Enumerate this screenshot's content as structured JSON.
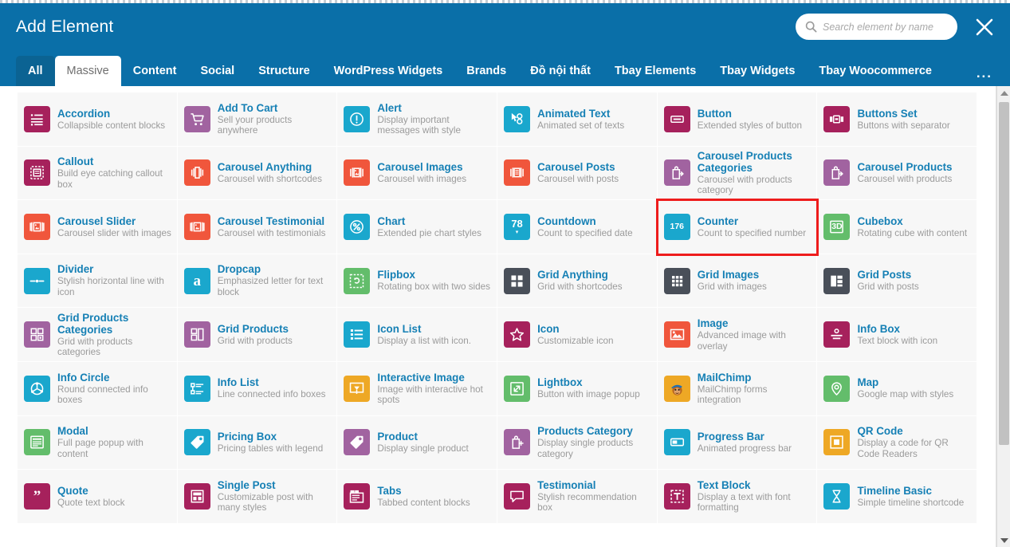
{
  "header": {
    "title": "Add Element",
    "search": {
      "placeholder": "Search element by name",
      "value": "",
      "icon": "search-icon"
    },
    "close_icon": "close-icon",
    "more_label": "..."
  },
  "tabs": [
    {
      "label": "All",
      "active": false,
      "first": true
    },
    {
      "label": "Massive",
      "active": true,
      "first": false
    },
    {
      "label": "Content",
      "active": false,
      "first": false
    },
    {
      "label": "Social",
      "active": false,
      "first": false
    },
    {
      "label": "Structure",
      "active": false,
      "first": false
    },
    {
      "label": "WordPress Widgets",
      "active": false,
      "first": false
    },
    {
      "label": "Brands",
      "active": false,
      "first": false
    },
    {
      "label": "Đồ nội thất",
      "active": false,
      "first": false
    },
    {
      "label": "Tbay Elements",
      "active": false,
      "first": false
    },
    {
      "label": "Tbay Widgets",
      "active": false,
      "first": false
    },
    {
      "label": "Tbay Woocommerce",
      "active": false,
      "first": false
    }
  ],
  "colors": {
    "header_blue": "#0a6fa8",
    "tab_active_bg": "#ffffff",
    "title_link": "#1680b5",
    "highlight_red": "#ee1c1c",
    "magenta": "#a6215c",
    "purple": "#a163a0",
    "cyan": "#1aa7cd",
    "orange": "#f0563c",
    "green": "#63bd6b",
    "dark": "#494f59",
    "amber": "#eea825"
  },
  "elements": [
    {
      "title": "Accordion",
      "desc": "Collapsible content blocks",
      "color": "#a6215c",
      "icon": "list-bullets-icon",
      "highlight": false
    },
    {
      "title": "Add To Cart",
      "desc": "Sell your products anywhere",
      "color": "#a163a0",
      "icon": "shopping-cart-icon",
      "highlight": false
    },
    {
      "title": "Alert",
      "desc": "Display important messages with style",
      "color": "#1aa7cd",
      "icon": "exclamation-circle-icon",
      "highlight": false
    },
    {
      "title": "Animated Text",
      "desc": "Animated set of texts",
      "color": "#1aa7cd",
      "icon": "animated-text-icon",
      "highlight": false
    },
    {
      "title": "Button",
      "desc": "Extended styles of button",
      "color": "#a6215c",
      "icon": "button-icon",
      "highlight": false
    },
    {
      "title": "Buttons Set",
      "desc": "Buttons with separator",
      "color": "#a6215c",
      "icon": "buttons-set-icon",
      "highlight": false
    },
    {
      "title": "Callout",
      "desc": "Build eye catching callout box",
      "color": "#a6215c",
      "icon": "callout-dashed-icon",
      "highlight": false
    },
    {
      "title": "Carousel Anything",
      "desc": "Carousel with shortcodes",
      "color": "#f0563c",
      "icon": "carousel-icon",
      "highlight": false
    },
    {
      "title": "Carousel Images",
      "desc": "Carousel with images",
      "color": "#f0563c",
      "icon": "carousel-image-icon",
      "highlight": false
    },
    {
      "title": "Carousel Posts",
      "desc": "Carousel with posts",
      "color": "#f0563c",
      "icon": "carousel-post-icon",
      "highlight": false
    },
    {
      "title": "Carousel Products Categories",
      "desc": "Carousel with products category",
      "color": "#a163a0",
      "icon": "bag-arrow-icon",
      "highlight": false
    },
    {
      "title": "Carousel Products",
      "desc": "Carousel with products",
      "color": "#a163a0",
      "icon": "bag-arrow-icon",
      "highlight": false
    },
    {
      "title": "Carousel Slider",
      "desc": "Carousel slider with images",
      "color": "#f0563c",
      "icon": "carousel-slider-icon",
      "highlight": false
    },
    {
      "title": "Carousel Testimonial",
      "desc": "Carousel with testimonials",
      "color": "#f0563c",
      "icon": "carousel-slider-icon",
      "highlight": false
    },
    {
      "title": "Chart",
      "desc": "Extended pie chart styles",
      "color": "#1aa7cd",
      "icon": "percent-circle-icon",
      "highlight": false
    },
    {
      "title": "Countdown",
      "desc": "Count to specified date",
      "color": "#1aa7cd",
      "icon": "number-78-icon",
      "badge": "78",
      "highlight": false
    },
    {
      "title": "Counter",
      "desc": "Count to specified number",
      "color": "#1aa7cd",
      "icon": "number-176-icon",
      "badge": "176",
      "highlight": true
    },
    {
      "title": "Cubebox",
      "desc": "Rotating cube with content",
      "color": "#63bd6b",
      "icon": "cube-3d-icon",
      "badge": "3D",
      "highlight": false
    },
    {
      "title": "Divider",
      "desc": "Stylish horizontal line with icon",
      "color": "#1aa7cd",
      "icon": "divider-icon",
      "highlight": false
    },
    {
      "title": "Dropcap",
      "desc": "Emphasized letter for text block",
      "color": "#1aa7cd",
      "icon": "letter-a-icon",
      "glyph": "a",
      "highlight": false
    },
    {
      "title": "Flipbox",
      "desc": "Rotating box with two sides",
      "color": "#63bd6b",
      "icon": "flip-box-icon",
      "highlight": false
    },
    {
      "title": "Grid Anything",
      "desc": "Grid with shortcodes",
      "color": "#494f59",
      "icon": "grid-4-icon",
      "highlight": false
    },
    {
      "title": "Grid Images",
      "desc": "Grid with images",
      "color": "#494f59",
      "icon": "grid-9-icon",
      "highlight": false
    },
    {
      "title": "Grid Posts",
      "desc": "Grid with posts",
      "color": "#494f59",
      "icon": "grid-posts-icon",
      "highlight": false
    },
    {
      "title": "Grid Products Categories",
      "desc": "Grid with products categories",
      "color": "#a163a0",
      "icon": "grid-products-categories-icon",
      "highlight": false
    },
    {
      "title": "Grid Products",
      "desc": "Grid with products",
      "color": "#a163a0",
      "icon": "grid-products-icon",
      "highlight": false
    },
    {
      "title": "Icon List",
      "desc": "Display a list with icon.",
      "color": "#1aa7cd",
      "icon": "icon-list-icon",
      "highlight": false
    },
    {
      "title": "Icon",
      "desc": "Customizable icon",
      "color": "#a6215c",
      "icon": "star-icon",
      "highlight": false
    },
    {
      "title": "Image",
      "desc": "Advanced image with overlay",
      "color": "#f0563c",
      "icon": "picture-icon",
      "highlight": false
    },
    {
      "title": "Info Box",
      "desc": "Text block with icon",
      "color": "#a6215c",
      "icon": "info-box-icon",
      "highlight": false
    },
    {
      "title": "Info Circle",
      "desc": "Round connected info boxes",
      "color": "#1aa7cd",
      "icon": "info-circle-nodes-icon",
      "highlight": false
    },
    {
      "title": "Info List",
      "desc": "Line connected info boxes",
      "color": "#1aa7cd",
      "icon": "info-list-icon",
      "highlight": false
    },
    {
      "title": "Interactive Image",
      "desc": "Image with interactive hot spots",
      "color": "#eea825",
      "icon": "interactive-image-icon",
      "highlight": false
    },
    {
      "title": "Lightbox",
      "desc": "Button with image popup",
      "color": "#63bd6b",
      "icon": "expand-arrow-icon",
      "highlight": false
    },
    {
      "title": "MailChimp",
      "desc": "MailChimp forms integration",
      "color": "#eea825",
      "icon": "mailchimp-monkey-icon",
      "highlight": false
    },
    {
      "title": "Map",
      "desc": "Google map with styles",
      "color": "#63bd6b",
      "icon": "map-pin-icon",
      "highlight": false
    },
    {
      "title": "Modal",
      "desc": "Full page popup with content",
      "color": "#63bd6b",
      "icon": "modal-window-icon",
      "highlight": false
    },
    {
      "title": "Pricing Box",
      "desc": "Pricing tables with legend",
      "color": "#1aa7cd",
      "icon": "price-tag-icon",
      "highlight": false
    },
    {
      "title": "Product",
      "desc": "Display single product",
      "color": "#a163a0",
      "icon": "price-tag-icon",
      "highlight": false
    },
    {
      "title": "Products Category",
      "desc": "Display single products category",
      "color": "#a163a0",
      "icon": "bag-plus-icon",
      "highlight": false
    },
    {
      "title": "Progress Bar",
      "desc": "Animated progress bar",
      "color": "#1aa7cd",
      "icon": "progress-bar-icon",
      "highlight": false
    },
    {
      "title": "QR Code",
      "desc": "Display a code for QR Code Readers",
      "color": "#eea825",
      "icon": "qr-square-icon",
      "highlight": false
    },
    {
      "title": "Quote",
      "desc": "Quote text block",
      "color": "#a6215c",
      "icon": "quote-marks-icon",
      "glyph": "”",
      "highlight": false
    },
    {
      "title": "Single Post",
      "desc": "Customizable post with many styles",
      "color": "#a6215c",
      "icon": "single-post-icon",
      "highlight": false
    },
    {
      "title": "Tabs",
      "desc": "Tabbed content blocks",
      "color": "#a6215c",
      "icon": "tabs-icon",
      "highlight": false
    },
    {
      "title": "Testimonial",
      "desc": "Stylish recommendation box",
      "color": "#a6215c",
      "icon": "speech-bubble-icon",
      "highlight": false
    },
    {
      "title": "Text Block",
      "desc": "Display a text with font formatting",
      "color": "#a6215c",
      "icon": "text-t-icon",
      "highlight": false
    },
    {
      "title": "Timeline Basic",
      "desc": "Simple timeline shortcode",
      "color": "#1aa7cd",
      "icon": "hourglass-icon",
      "highlight": false
    }
  ],
  "scrollbar": {
    "up_icon": "scroll-up-arrow-icon",
    "down_icon": "scroll-down-arrow-icon",
    "thumb": "scroll-thumb"
  }
}
